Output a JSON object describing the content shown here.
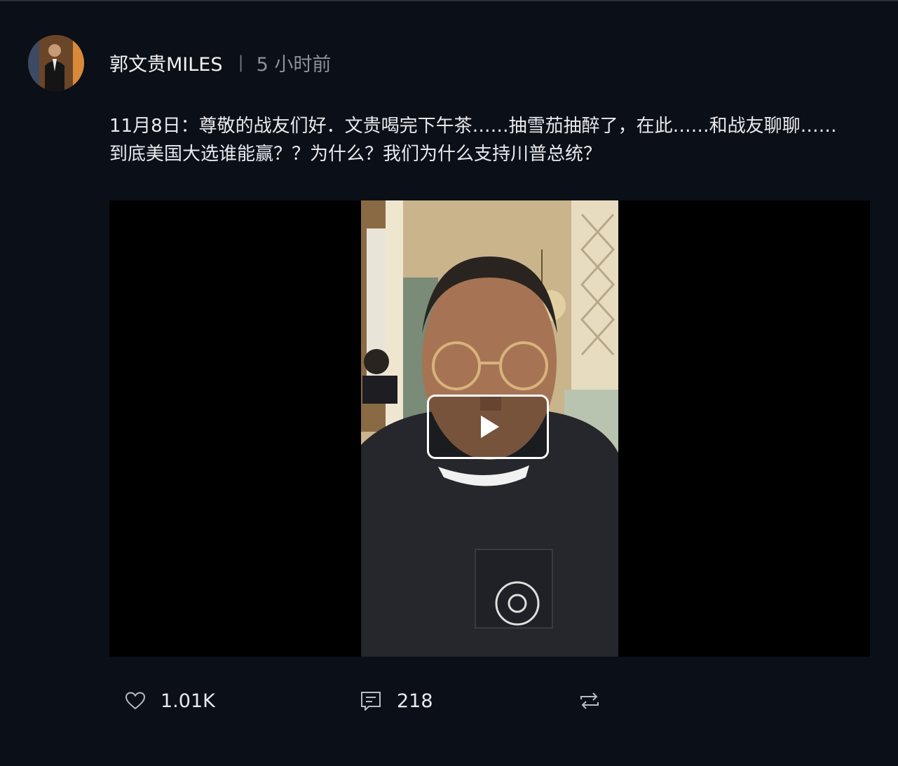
{
  "post": {
    "author": "郭文贵MILES",
    "separator": "|",
    "time": "5 小时前",
    "text": "11月8日：尊敬的战友们好．文贵喝完下午茶……抽雪茄抽醉了，在此……和战友聊聊……\n到底美国大选谁能赢？？为什么？我们为什么支持川普总统？",
    "avatar_icon": "user-avatar-photo",
    "video": {
      "play_icon": "play-icon"
    }
  },
  "actions": {
    "like": {
      "icon": "heart-icon",
      "count": "1.01K"
    },
    "comment": {
      "icon": "comment-icon",
      "count": "218"
    },
    "repost": {
      "icon": "repost-icon"
    }
  },
  "colors": {
    "background": "#0b0f17",
    "text": "#e9eaee",
    "muted": "#8a909b"
  }
}
